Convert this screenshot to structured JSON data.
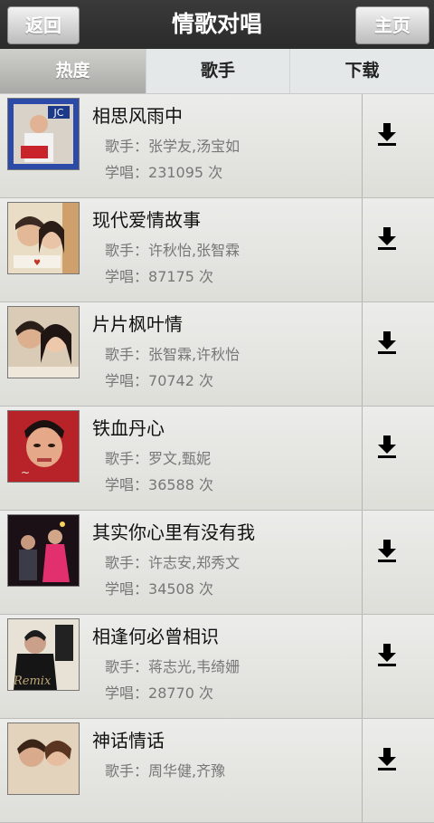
{
  "header": {
    "title": "情歌对唱",
    "back_label": "返回",
    "home_label": "主页"
  },
  "tabs": [
    {
      "label": "热度",
      "selected": true
    },
    {
      "label": "歌手",
      "selected": false
    },
    {
      "label": "下载",
      "selected": false
    }
  ],
  "singer_prefix": "歌手：",
  "plays_prefix": "学唱：",
  "plays_suffix": "次",
  "songs": [
    {
      "title": "相思风雨中",
      "singers": "张学友,汤宝如",
      "plays": "231095"
    },
    {
      "title": "现代爱情故事",
      "singers": "许秋怡,张智霖",
      "plays": "87175"
    },
    {
      "title": "片片枫叶情",
      "singers": "张智霖,许秋怡",
      "plays": "70742"
    },
    {
      "title": "铁血丹心",
      "singers": "罗文,甄妮",
      "plays": "36588"
    },
    {
      "title": "其实你心里有没有我",
      "singers": "许志安,郑秀文",
      "plays": "34508"
    },
    {
      "title": "相逢何必曾相识",
      "singers": "蒋志光,韦绮姗",
      "plays": "28770"
    },
    {
      "title": "神话情话",
      "singers": "周华健,齐豫",
      "plays": ""
    }
  ],
  "icons": {
    "download": "download-arrow-icon"
  },
  "colors": {
    "topbar": "#2f2f2f",
    "selected_tab": "#b9b9b6",
    "row_bg": "#e6e6e3"
  }
}
